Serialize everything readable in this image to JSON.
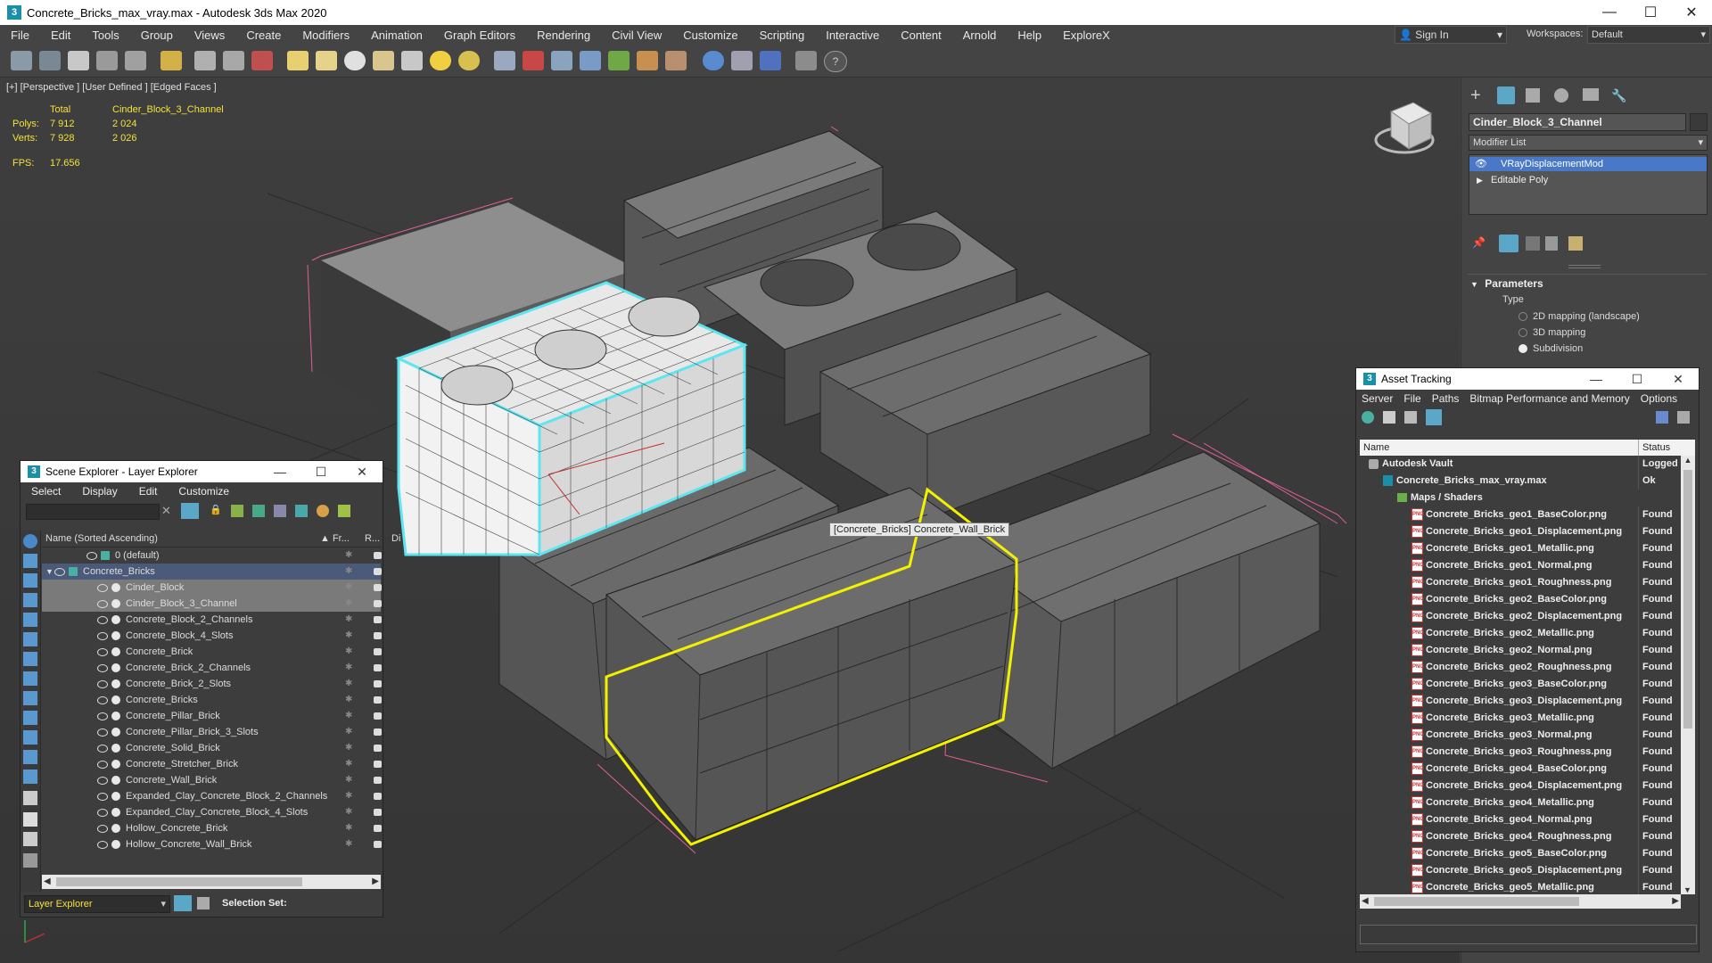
{
  "window": {
    "title": "Concrete_Bricks_max_vray.max - Autodesk 3ds Max 2020",
    "controls": [
      "—",
      "☐",
      "✕"
    ]
  },
  "menu": {
    "items": [
      "File",
      "Edit",
      "Tools",
      "Group",
      "Views",
      "Create",
      "Modifiers",
      "Animation",
      "Graph Editors",
      "Rendering",
      "Civil View",
      "Customize",
      "Scripting",
      "Interactive",
      "Content",
      "Arnold",
      "Help",
      "ExploreX"
    ],
    "sign_in": "Sign In",
    "workspaces_label": "Workspaces:",
    "workspace": "Default"
  },
  "viewport": {
    "label": "[+] [Perspective ] [User Defined ] [Edged Faces ]",
    "stats": {
      "total_header": "Total",
      "object_header": "Cinder_Block_3_Channel",
      "polys_label": "Polys:",
      "polys_total": "7 912",
      "polys_obj": "2 024",
      "verts_label": "Verts:",
      "verts_total": "7 928",
      "verts_obj": "2 026",
      "fps_label": "FPS:",
      "fps": "17.656"
    },
    "tooltip": "[Concrete_Bricks] Concrete_Wall_Brick"
  },
  "command_panel": {
    "object_name": "Cinder_Block_3_Channel",
    "modifier_list": "Modifier List",
    "modifiers": [
      "VRayDisplacementMod",
      "Editable Poly"
    ],
    "parameters_title": "Parameters",
    "type_label": "Type",
    "type_options": [
      "2D mapping (landscape)",
      "3D mapping",
      "Subdivision"
    ],
    "selected_type_index": 2
  },
  "scene_explorer": {
    "title": "Scene Explorer - Layer Explorer",
    "menu": [
      "Select",
      "Display",
      "Edit",
      "Customize"
    ],
    "col_name": "Name (Sorted Ascending)",
    "col_fr": "▲ Fr...",
    "col_r": "R...",
    "col_d": "Di",
    "rows": [
      {
        "name": "0 (default)",
        "level": 1,
        "kind": "layer"
      },
      {
        "name": "Concrete_Bricks",
        "level": 0,
        "kind": "layer-open"
      },
      {
        "name": "Cinder_Block",
        "level": 2,
        "kind": "obj"
      },
      {
        "name": "Cinder_Block_3_Channel",
        "level": 2,
        "kind": "obj"
      },
      {
        "name": "Concrete_Block_2_Channels",
        "level": 2,
        "kind": "obj"
      },
      {
        "name": "Concrete_Block_4_Slots",
        "level": 2,
        "kind": "obj"
      },
      {
        "name": "Concrete_Brick",
        "level": 2,
        "kind": "obj"
      },
      {
        "name": "Concrete_Brick_2_Channels",
        "level": 2,
        "kind": "obj"
      },
      {
        "name": "Concrete_Brick_2_Slots",
        "level": 2,
        "kind": "obj"
      },
      {
        "name": "Concrete_Bricks",
        "level": 2,
        "kind": "obj"
      },
      {
        "name": "Concrete_Pillar_Brick",
        "level": 2,
        "kind": "obj"
      },
      {
        "name": "Concrete_Pillar_Brick_3_Slots",
        "level": 2,
        "kind": "obj"
      },
      {
        "name": "Concrete_Solid_Brick",
        "level": 2,
        "kind": "obj"
      },
      {
        "name": "Concrete_Stretcher_Brick",
        "level": 2,
        "kind": "obj"
      },
      {
        "name": "Concrete_Wall_Brick",
        "level": 2,
        "kind": "obj"
      },
      {
        "name": "Expanded_Clay_Concrete_Block_2_Channels",
        "level": 2,
        "kind": "obj"
      },
      {
        "name": "Expanded_Clay_Concrete_Block_4_Slots",
        "level": 2,
        "kind": "obj"
      },
      {
        "name": "Hollow_Concrete_Brick",
        "level": 2,
        "kind": "obj"
      },
      {
        "name": "Hollow_Concrete_Wall_Brick",
        "level": 2,
        "kind": "obj"
      }
    ],
    "footer_label": "Layer Explorer",
    "selection_set_label": "Selection Set:"
  },
  "asset_tracking": {
    "title": "Asset Tracking",
    "menu": [
      "Server",
      "File",
      "Paths",
      "Bitmap Performance and Memory",
      "Options"
    ],
    "col_name": "Name",
    "col_status": "Status",
    "rows": [
      {
        "name": "Autodesk Vault",
        "status": "Logged O",
        "level": 0,
        "kind": "vault"
      },
      {
        "name": "Concrete_Bricks_max_vray.max",
        "status": "Ok",
        "level": 1,
        "kind": "max"
      },
      {
        "name": "Maps / Shaders",
        "status": "",
        "level": 2,
        "kind": "folder"
      },
      {
        "name": "Concrete_Bricks_geo1_BaseColor.png",
        "status": "Found",
        "level": 3,
        "kind": "png"
      },
      {
        "name": "Concrete_Bricks_geo1_Displacement.png",
        "status": "Found",
        "level": 3,
        "kind": "png"
      },
      {
        "name": "Concrete_Bricks_geo1_Metallic.png",
        "status": "Found",
        "level": 3,
        "kind": "png"
      },
      {
        "name": "Concrete_Bricks_geo1_Normal.png",
        "status": "Found",
        "level": 3,
        "kind": "png"
      },
      {
        "name": "Concrete_Bricks_geo1_Roughness.png",
        "status": "Found",
        "level": 3,
        "kind": "png"
      },
      {
        "name": "Concrete_Bricks_geo2_BaseColor.png",
        "status": "Found",
        "level": 3,
        "kind": "png"
      },
      {
        "name": "Concrete_Bricks_geo2_Displacement.png",
        "status": "Found",
        "level": 3,
        "kind": "png"
      },
      {
        "name": "Concrete_Bricks_geo2_Metallic.png",
        "status": "Found",
        "level": 3,
        "kind": "png"
      },
      {
        "name": "Concrete_Bricks_geo2_Normal.png",
        "status": "Found",
        "level": 3,
        "kind": "png"
      },
      {
        "name": "Concrete_Bricks_geo2_Roughness.png",
        "status": "Found",
        "level": 3,
        "kind": "png"
      },
      {
        "name": "Concrete_Bricks_geo3_BaseColor.png",
        "status": "Found",
        "level": 3,
        "kind": "png"
      },
      {
        "name": "Concrete_Bricks_geo3_Displacement.png",
        "status": "Found",
        "level": 3,
        "kind": "png"
      },
      {
        "name": "Concrete_Bricks_geo3_Metallic.png",
        "status": "Found",
        "level": 3,
        "kind": "png"
      },
      {
        "name": "Concrete_Bricks_geo3_Normal.png",
        "status": "Found",
        "level": 3,
        "kind": "png"
      },
      {
        "name": "Concrete_Bricks_geo3_Roughness.png",
        "status": "Found",
        "level": 3,
        "kind": "png"
      },
      {
        "name": "Concrete_Bricks_geo4_BaseColor.png",
        "status": "Found",
        "level": 3,
        "kind": "png"
      },
      {
        "name": "Concrete_Bricks_geo4_Displacement.png",
        "status": "Found",
        "level": 3,
        "kind": "png"
      },
      {
        "name": "Concrete_Bricks_geo4_Metallic.png",
        "status": "Found",
        "level": 3,
        "kind": "png"
      },
      {
        "name": "Concrete_Bricks_geo4_Normal.png",
        "status": "Found",
        "level": 3,
        "kind": "png"
      },
      {
        "name": "Concrete_Bricks_geo4_Roughness.png",
        "status": "Found",
        "level": 3,
        "kind": "png"
      },
      {
        "name": "Concrete_Bricks_geo5_BaseColor.png",
        "status": "Found",
        "level": 3,
        "kind": "png"
      },
      {
        "name": "Concrete_Bricks_geo5_Displacement.png",
        "status": "Found",
        "level": 3,
        "kind": "png"
      },
      {
        "name": "Concrete_Bricks_geo5_Metallic.png",
        "status": "Found",
        "level": 3,
        "kind": "png"
      }
    ]
  },
  "colors": {
    "accent": "#1a8fa8",
    "selected_cyan": "#5ee6f0",
    "selected_yellow": "#f2f200",
    "stats_yellow": "#f5e23c",
    "pink_bounds": "#e0609a",
    "highlight_blue": "#4a78c8"
  }
}
